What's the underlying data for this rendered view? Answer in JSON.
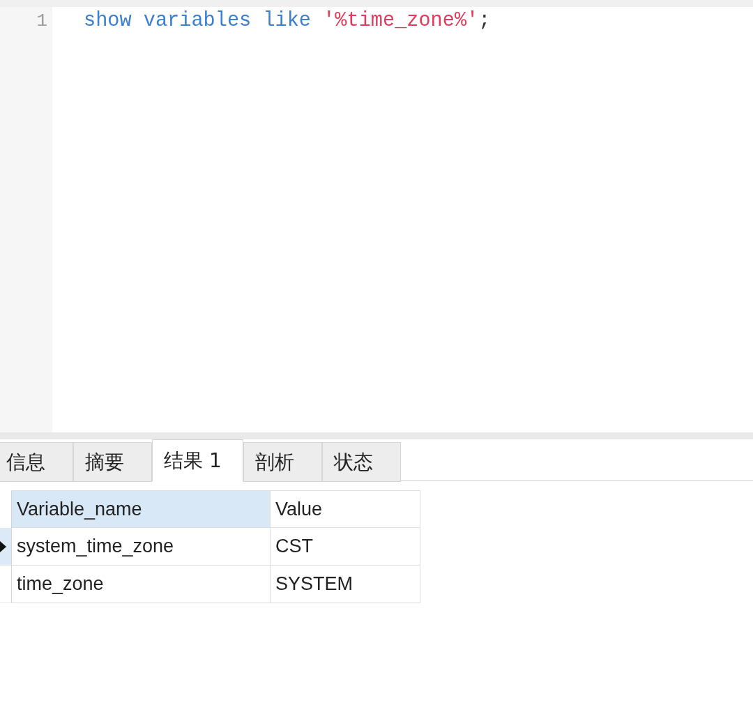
{
  "editor": {
    "lines": [
      {
        "number": "1",
        "tokens": [
          {
            "kind": "keyword",
            "text": "show variables like "
          },
          {
            "kind": "string",
            "text": "'%time_zone%'"
          },
          {
            "kind": "plain",
            "text": ";"
          }
        ]
      }
    ]
  },
  "result_tabs": [
    {
      "label": "信息",
      "selected": false
    },
    {
      "label": "摘要",
      "selected": false
    },
    {
      "label": "结果 1",
      "selected": true
    },
    {
      "label": "剖析",
      "selected": false
    },
    {
      "label": "状态",
      "selected": false
    }
  ],
  "result_grid": {
    "columns": [
      {
        "label": "Variable_name",
        "selected": true
      },
      {
        "label": "Value",
        "selected": false
      }
    ],
    "rows": [
      {
        "current": true,
        "cells": [
          "system_time_zone",
          "CST"
        ]
      },
      {
        "current": false,
        "cells": [
          "time_zone",
          "SYSTEM"
        ]
      }
    ]
  }
}
